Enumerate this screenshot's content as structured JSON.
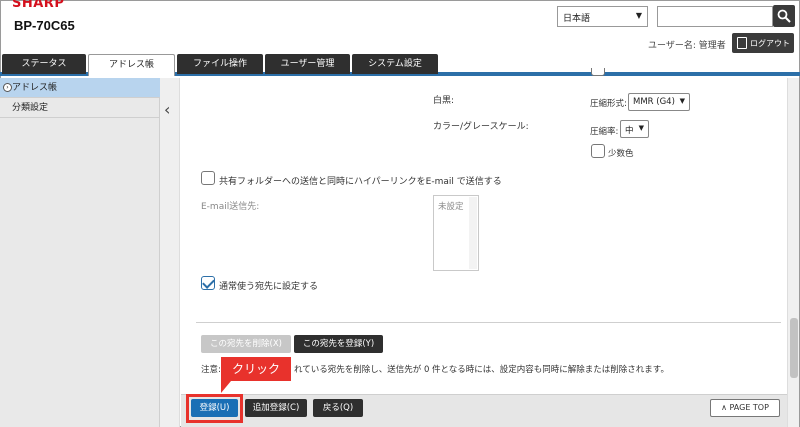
{
  "header": {
    "brand": "SHARP",
    "model": "BP-70C65",
    "language": "日本語",
    "search_value": "",
    "user_label": "ユーザー名: 管理者",
    "logout_label": "ログアウト"
  },
  "tabs": [
    {
      "label": "ステータス"
    },
    {
      "label": "アドレス帳"
    },
    {
      "label": "ファイル操作"
    },
    {
      "label": "ユーザー管理"
    },
    {
      "label": "システム設定"
    }
  ],
  "sidebar": {
    "items": [
      {
        "label": "アドレス帳"
      },
      {
        "label": "分類設定"
      }
    ]
  },
  "main": {
    "mono_label": "白黒:",
    "color_label": "カラー/グレースケール:",
    "compress_format_label": "圧縮形式:",
    "compress_format_value": "MMR (G4)",
    "compress_rate_label": "圧縮率:",
    "compress_rate_value": "中",
    "few_colors_label": "少数色",
    "hyperlink_label": "共有フォルダーへの送信と同時にハイパーリンクをE-mail で送信する",
    "email_dest_label": "E-mail送信先:",
    "email_dest_value": "未設定",
    "frequent_label": "通常使う宛先に設定する",
    "delete_button": "この宛先を削除(X)",
    "register_dest_button": "この宛先を登録(Y)",
    "notice": "注意: このアドレスは登録されている宛先を削除し、送信先が 0 件となる時には、設定内容も同時に解除または削除されます。",
    "notice_prefix": "注意:",
    "notice_visible": "れている宛先を削除し、送信先が 0 件となる時には、設定内容も同時に解除または削除されます。"
  },
  "footer": {
    "register_button": "登録(U)",
    "add_register_button": "追加登録(C)",
    "back_button": "戻る(Q)",
    "page_top": "PAGE TOP"
  },
  "annotation": {
    "callout": "クリック"
  },
  "colors": {
    "brand_red": "#d4101d",
    "accent_blue": "#2c6fa8",
    "callout_red": "#e8322c"
  }
}
